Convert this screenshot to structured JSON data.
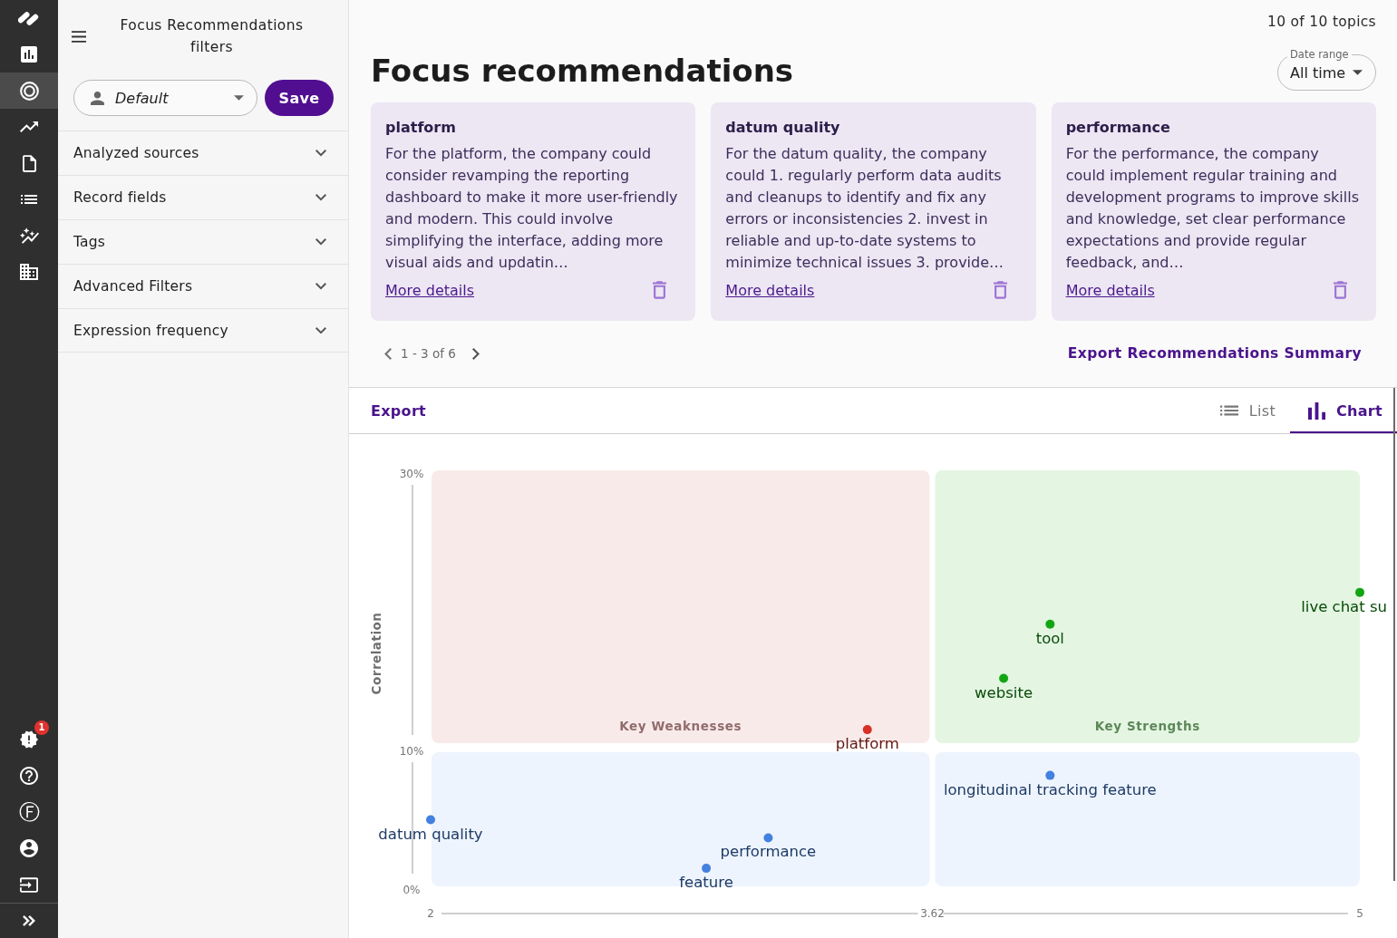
{
  "rail": {
    "nav_items": [
      {
        "selected": false
      },
      {
        "selected": true
      },
      {
        "selected": false
      },
      {
        "selected": false
      },
      {
        "selected": false
      },
      {
        "selected": false
      },
      {
        "selected": false
      }
    ],
    "alerts_badge": "1",
    "account_glyph": "Ⓕ"
  },
  "filters": {
    "title": "Focus Recommendations filters",
    "preset": {
      "value": "Default"
    },
    "save_label": "Save",
    "sections": [
      {
        "label": "Analyzed sources",
        "expanded": false
      },
      {
        "label": "Record fields",
        "expanded": false
      },
      {
        "label": "Tags",
        "expanded": false
      },
      {
        "label": "Advanced Filters",
        "expanded": false
      },
      {
        "label": "Expression frequency",
        "expanded": false
      }
    ]
  },
  "header": {
    "topic_count": "10 of 10 topics",
    "title": "Focus recommendations",
    "date_range": {
      "label": "Date range",
      "value": "All time"
    }
  },
  "recommendations": [
    {
      "title": "platform",
      "body": "For the platform, the company could consider revamping the reporting dashboard to make it more user-friendly and modern. This could involve simplifying the interface, adding more visual aids and updatin…",
      "link": "More details"
    },
    {
      "title": "datum quality",
      "body": "For the datum quality, the company could 1. regularly perform data audits and cleanups to identify and fix any errors or inconsistencies 2. invest in reliable and up-to-date systems to minimize technical issues 3. provide…",
      "link": "More details"
    },
    {
      "title": "performance",
      "body": "For the performance, the company could implement regular training and development programs to improve skills and knowledge, set clear performance expectations and provide regular feedback, and…",
      "link": "More details"
    }
  ],
  "pagination": {
    "range": "1 - 3 of 6"
  },
  "export_summary": "Export Recommendations Summary",
  "view_bar": {
    "export": "Export",
    "tabs": [
      {
        "label": "List",
        "kind": "list",
        "selected": false
      },
      {
        "label": "Chart",
        "kind": "chart",
        "selected": true
      }
    ]
  },
  "chart": {
    "quadrants": [
      {
        "label": "Key Weaknesses",
        "color": "#f9eaea"
      },
      {
        "label": "Key Strengths",
        "color": "#e4f5e2"
      },
      {
        "color": "#edf4fd"
      },
      {
        "color": "#edf4fd"
      }
    ],
    "chart_data": {
      "type": "scatter",
      "ylabel": "Correlation",
      "xlim": [
        2,
        5
      ],
      "ylim": [
        0,
        30
      ],
      "xticks": [
        {
          "value": 2,
          "label": "2"
        },
        {
          "value": 3.62,
          "label": "3.62"
        },
        {
          "value": 5,
          "label": "5"
        }
      ],
      "yticks": [
        {
          "value": 0,
          "label": "0%"
        },
        {
          "value": 10,
          "label": "10%"
        },
        {
          "value": 30,
          "label": "30%"
        }
      ],
      "series": [
        {
          "name": "platform",
          "color": "#d93025",
          "x": [
            3.41
          ],
          "values": [
            11.3
          ]
        },
        {
          "name": "live chat su",
          "color": "#12a512",
          "x": [
            5.0
          ],
          "values": [
            21.2
          ]
        },
        {
          "name": "tool",
          "color": "#12a512",
          "x": [
            4.0
          ],
          "values": [
            18.9
          ]
        },
        {
          "name": "website",
          "color": "#12a512",
          "x": [
            3.85
          ],
          "values": [
            15.0
          ]
        },
        {
          "name": "longitudinal tracking feature",
          "color": "#4380e0",
          "x": [
            4.0
          ],
          "values": [
            8.0
          ]
        },
        {
          "name": "datum quality",
          "color": "#4380e0",
          "x": [
            2.0
          ],
          "values": [
            4.8
          ]
        },
        {
          "name": "performance",
          "color": "#4380e0",
          "x": [
            3.09
          ],
          "values": [
            3.5
          ]
        },
        {
          "name": "feature",
          "color": "#4380e0",
          "x": [
            2.89
          ],
          "values": [
            1.3
          ]
        }
      ]
    }
  }
}
